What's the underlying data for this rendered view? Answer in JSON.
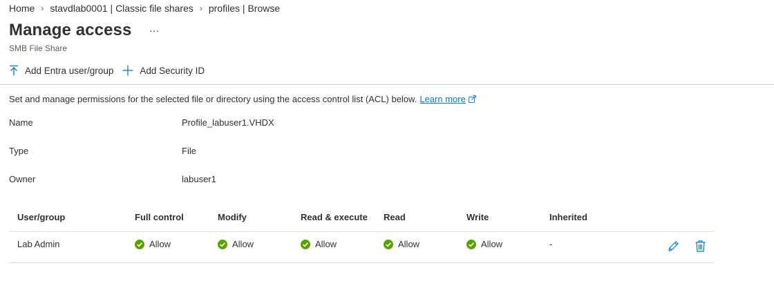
{
  "breadcrumb": {
    "items": [
      "Home",
      "stavdlab0001 | Classic file shares",
      "profiles | Browse"
    ]
  },
  "header": {
    "title": "Manage access",
    "more": "...",
    "subtitle": "SMB File Share"
  },
  "toolbar": {
    "add_entra_label": "Add Entra user/group",
    "add_entra_icon": "upload-arrow-icon",
    "add_sid_label": "Add Security ID",
    "add_sid_icon": "plus-icon"
  },
  "description": {
    "text": "Set and manage permissions for the selected file or directory using the access control list (ACL) below.",
    "link": "Learn more",
    "link_icon": "external-link-icon"
  },
  "properties": [
    {
      "label": "Name",
      "value": "Profile_labuser1.VHDX"
    },
    {
      "label": "Type",
      "value": "File"
    },
    {
      "label": "Owner",
      "value": "labuser1"
    }
  ],
  "acl": {
    "columns": [
      "User/group",
      "Full control",
      "Modify",
      "Read & execute",
      "Read",
      "Write",
      "Inherited"
    ],
    "rows": [
      {
        "user": "Lab Admin",
        "full_control": "Allow",
        "modify": "Allow",
        "read_execute": "Allow",
        "read": "Allow",
        "write": "Allow",
        "inherited": "-"
      }
    ]
  },
  "colors": {
    "accent": "#0078d4",
    "allow_green": "#57a300",
    "text": "#323130",
    "secondary_text": "#605e5c"
  }
}
